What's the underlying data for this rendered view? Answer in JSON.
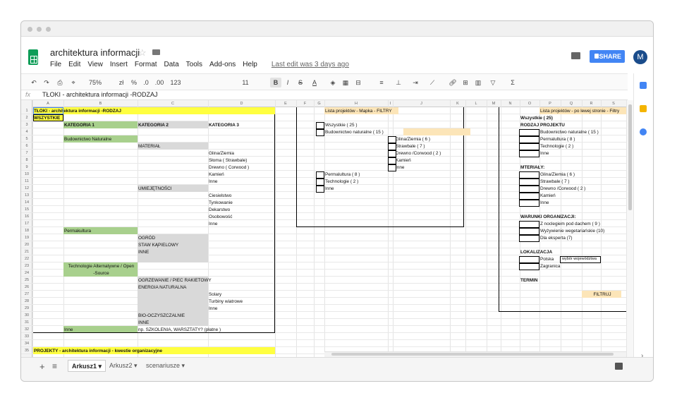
{
  "doc": {
    "title": "architektura informacji",
    "menu": [
      "File",
      "Edit",
      "View",
      "Insert",
      "Format",
      "Data",
      "Tools",
      "Add-ons",
      "Help"
    ],
    "last_edit": "Last edit was 3 days ago",
    "share_label": "SHARE",
    "avatar_letter": "M"
  },
  "toolbar": {
    "zoom": "75%",
    "currency": "zł",
    "percent": "%",
    "dec0": ".0",
    "dec00": ".00",
    "format123": "123",
    "font_size": "11",
    "bold": "B",
    "italic": "I",
    "strike": "S",
    "textcolor": "A"
  },
  "formula": {
    "fx": "fx",
    "value": "TŁOKI - architektura informacji -RODZAJ"
  },
  "columns": [
    "A",
    "B",
    "C",
    "D",
    "E",
    "F",
    "G",
    "H",
    "I",
    "J",
    "K",
    "L",
    "M",
    "N",
    "O",
    "P",
    "Q",
    "R",
    "S"
  ],
  "rows": [
    "1",
    "2",
    "3",
    "4",
    "5",
    "6",
    "7",
    "8",
    "9",
    "10",
    "11",
    "12",
    "13",
    "14",
    "15",
    "16",
    "17",
    "18",
    "19",
    "20",
    "21",
    "22",
    "23",
    "24",
    "25",
    "26",
    "27",
    "28",
    "29",
    "30",
    "31",
    "32",
    "33",
    "34",
    "35"
  ],
  "left": {
    "r1": "TŁOKI - architektura informacji -RODZAJ",
    "r2": "WSZYSTKIE",
    "kat1": "KATEGORIA 1",
    "kat2": "KATEGORIA 2",
    "kat3": "KATEGORIA 3",
    "bud": "Budownictwo Naturalne",
    "material": "MATERIAŁ",
    "glina": "Glina/Ziemia",
    "sloma": "Słoma ( Strawbale)",
    "drewno": "Drewno ( Corwood )",
    "kamien": "Kamień",
    "inne1": "Inne",
    "umiej": "UMIEJĘTNOŚCI",
    "ciesielstwo": "Ciesielstwo",
    "tynkowanie": "Tynkowanie",
    "dekarstwo": "Dekarstwo",
    "osobowosc": "Osobowość",
    "inne2": "Inne",
    "perma": "Permakultura",
    "ogrod": "OGRÓD",
    "staw": "STAW KĄPIELOWY",
    "inne3": "INNE",
    "tech1": "Technologie Alternatywne / Open",
    "tech2": "-Source",
    "ogrzew": "OGRZEWANIE / PIEC RAKIETOWY",
    "energia": "ENERGIA NATURALNA",
    "solary": "Solary",
    "turbiny": "Turbiny wiatrowe",
    "inne4": "Inne",
    "bio": "BIO-OCZYSZCZALNIE",
    "inne5": "INNE",
    "inne6": "Inne",
    "szkolenia": "np. SZKOLENIA, WARSZTATY? (płatne )",
    "r35": "PROJEKTY - architektura informacji - kwestie organizacyjne"
  },
  "mid": {
    "header": "Lista projektów - Mapka - FILTRY",
    "wszystkie": "Wszystkie  ( 25 )",
    "bud": "Budownictwo naturalne ( 15 )",
    "glina": "Glina/Ziemia ( 6 )",
    "strawbale": "Strawbale ( 7 )",
    "drewno": "Drewno /Corwood ( 2 )",
    "kamien": "Kamień",
    "inne": "Inne",
    "perma": "Permalultura ( 8 )",
    "tech": "Technologie ( 2 )",
    "inne2": "Inne"
  },
  "right": {
    "header": "Lista projektów - po lewej stronie -  Filtry",
    "wszystkie": "Wszystkie  ( 25)",
    "rodzaj": "RODZAJ PROJEKTU",
    "bud": "Budownictwo naturalne ( 15 )",
    "perma": "Permalultura ( 8 )",
    "tech": "Technologie ( 2 )",
    "inne": "Inne",
    "mat": "MTERIAŁY:",
    "glina": "Glina/Ziemia ( 6 )",
    "strawbale": "Strawbale ( 7 )",
    "drewno": "Drewno /Corwood ( 2 )",
    "kamien": "Kamień",
    "inne2": "Inne",
    "warunki": "WARUNKI ORGANIZACJI:",
    "nocleg": "Z noclegiem pod dachem  ( 9 )",
    "wyzyw": "Wyżywienie wegetariańskie (10)",
    "ekspert": "Dla eksperta (7)",
    "lokal": "LOKALIZACJA",
    "polska": "Polska",
    "woj": "wybór województwa",
    "zagranica": "Zagranica",
    "termin": "TERMIN",
    "filtruj": "FILTRUJ"
  },
  "sheets": [
    "Arkusz1",
    "Arkusz2",
    "scenariusze"
  ],
  "colors": {
    "yellow": "#ffff40",
    "green": "#a8d08d",
    "gray": "#d9d9d9",
    "peach": "#fce5b8",
    "share": "#4285f4"
  }
}
